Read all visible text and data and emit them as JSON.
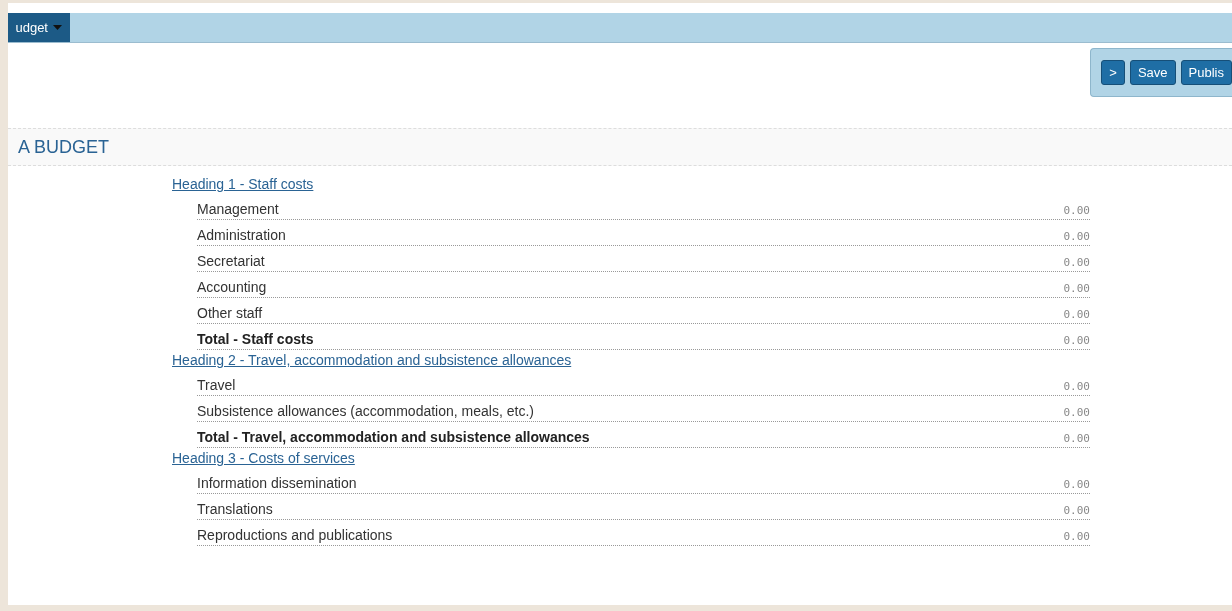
{
  "menu_bar": {
    "menu": "udget"
  },
  "toolbar": {
    "buttons": [
      ">",
      "Save",
      "Publis"
    ]
  },
  "section": {
    "title": "A BUDGET"
  },
  "groups": [
    {
      "heading": "Heading 1 - Staff costs",
      "rows": [
        {
          "label": "Management",
          "value": "0.00",
          "kind": "item"
        },
        {
          "label": "Administration",
          "value": "0.00",
          "kind": "item"
        },
        {
          "label": "Secretariat",
          "value": "0.00",
          "kind": "item"
        },
        {
          "label": "Accounting",
          "value": "0.00",
          "kind": "item"
        },
        {
          "label": "Other staff",
          "value": "0.00",
          "kind": "item"
        },
        {
          "label": "Total - Staff costs",
          "value": "0.00",
          "kind": "total"
        }
      ]
    },
    {
      "heading": "Heading 2 - Travel, accommodation and subsistence allowances",
      "rows": [
        {
          "label": "Travel",
          "value": "0.00",
          "kind": "item"
        },
        {
          "label": "Subsistence allowances (accommodation, meals, etc.)",
          "value": "0.00",
          "kind": "item"
        },
        {
          "label": "Total - Travel, accommodation and subsistence allowances",
          "value": "0.00",
          "kind": "total"
        }
      ]
    },
    {
      "heading": "Heading 3 - Costs of services",
      "rows": [
        {
          "label": "Information dissemination",
          "value": "0.00",
          "kind": "item"
        },
        {
          "label": "Translations",
          "value": "0.00",
          "kind": "item"
        },
        {
          "label": "Reproductions and publications",
          "value": "0.00",
          "kind": "item"
        }
      ]
    }
  ]
}
